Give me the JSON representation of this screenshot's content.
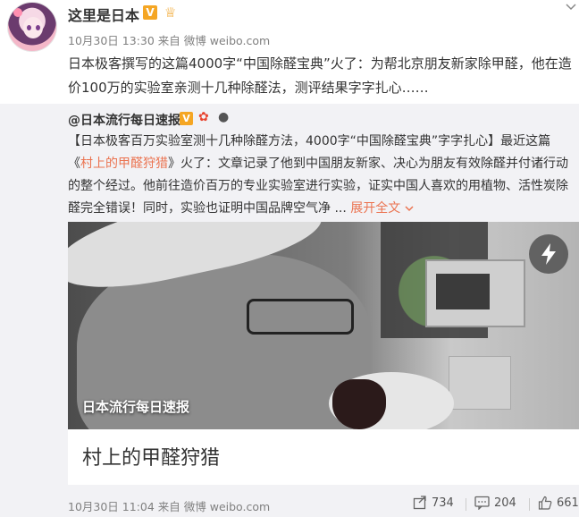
{
  "post": {
    "username": "这里是日本",
    "meta": "10月30日 13:30 来自 微博 weibo.com",
    "text": "日本极客撰写的这篇4000字“中国除醛宝典”火了：为帮北京朋友新家除甲醛，他在造价100万的实验室亲测十几种除醛法，测评结果字字扎心……"
  },
  "repost": {
    "username": "@日本流行每日速报",
    "text_lead": "【日本极客百万实验室测十几种除醛方法，4000字“中国除醛宝典”字字扎心】最近这篇《",
    "text_highlight": "村上的甲醛狩猎",
    "text_rest": "》火了：文章记录了他到中国朋友新家、决心为朋友有效除醛并付诸行动的整个经过。他前往造价百万的专业实验室进行实验，证实中国人喜欢的用植物、活性炭除醛完全错误！同时，实验也证明中国品牌空气净 ... ",
    "expand_label": "展开全文",
    "image_caption": "日本流行每日速报",
    "card_title": "村上的甲醛狩猎",
    "meta": "10月30日 11:04 来自 微博 weibo.com",
    "actions": {
      "repost_count": "734",
      "comment_count": "204",
      "like_count": "661"
    }
  },
  "colors": {
    "link": "#eb7350",
    "badge": "#f5a623"
  }
}
